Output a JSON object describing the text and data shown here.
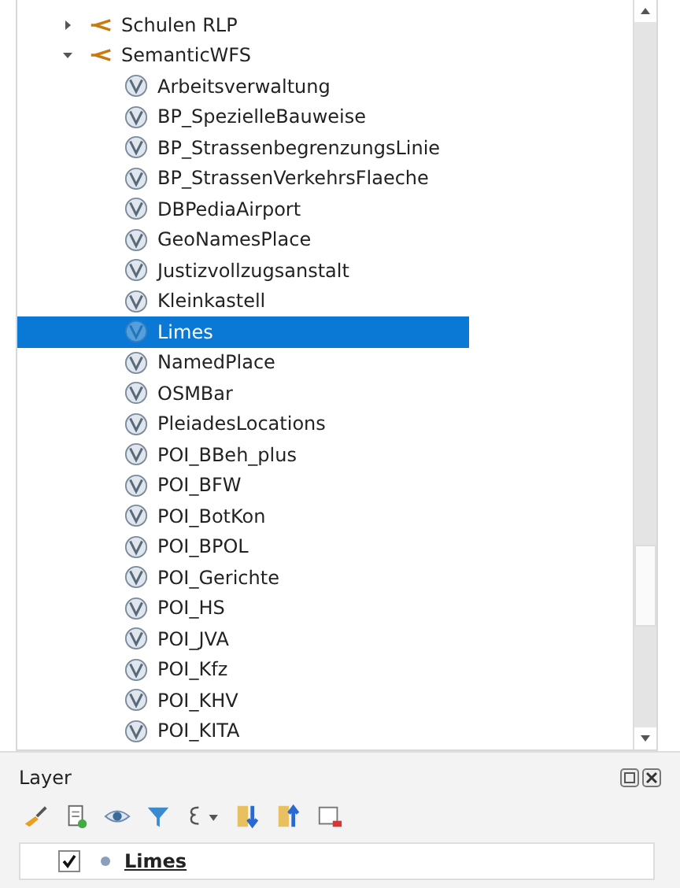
{
  "tree": [
    {
      "label": "Schulen RLP",
      "expanded": false
    },
    {
      "label": "SemanticWFS",
      "expanded": true,
      "children": [
        {
          "label": "Arbeitsverwaltung",
          "selected": false
        },
        {
          "label": "BP_SpezielleBauweise",
          "selected": false
        },
        {
          "label": "BP_StrassenbegrenzungsLinie",
          "selected": false
        },
        {
          "label": "BP_StrassenVerkehrsFlaeche",
          "selected": false
        },
        {
          "label": "DBPediaAirport",
          "selected": false
        },
        {
          "label": "GeoNamesPlace",
          "selected": false
        },
        {
          "label": "Justizvollzugsanstalt",
          "selected": false
        },
        {
          "label": "Kleinkastell",
          "selected": false
        },
        {
          "label": "Limes",
          "selected": true
        },
        {
          "label": "NamedPlace",
          "selected": false
        },
        {
          "label": "OSMBar",
          "selected": false
        },
        {
          "label": "PleiadesLocations",
          "selected": false
        },
        {
          "label": "POI_BBeh_plus",
          "selected": false
        },
        {
          "label": "POI_BFW",
          "selected": false
        },
        {
          "label": "POI_BotKon",
          "selected": false
        },
        {
          "label": "POI_BPOL",
          "selected": false
        },
        {
          "label": "POI_Gerichte",
          "selected": false
        },
        {
          "label": "POI_HS",
          "selected": false
        },
        {
          "label": "POI_JVA",
          "selected": false
        },
        {
          "label": "POI_Kfz",
          "selected": false
        },
        {
          "label": "POI_KHV",
          "selected": false
        },
        {
          "label": "POI_KITA",
          "selected": false
        }
      ]
    }
  ],
  "layer_panel": {
    "title": "Layer",
    "layers": [
      {
        "name": "Limes",
        "checked": true
      }
    ]
  }
}
